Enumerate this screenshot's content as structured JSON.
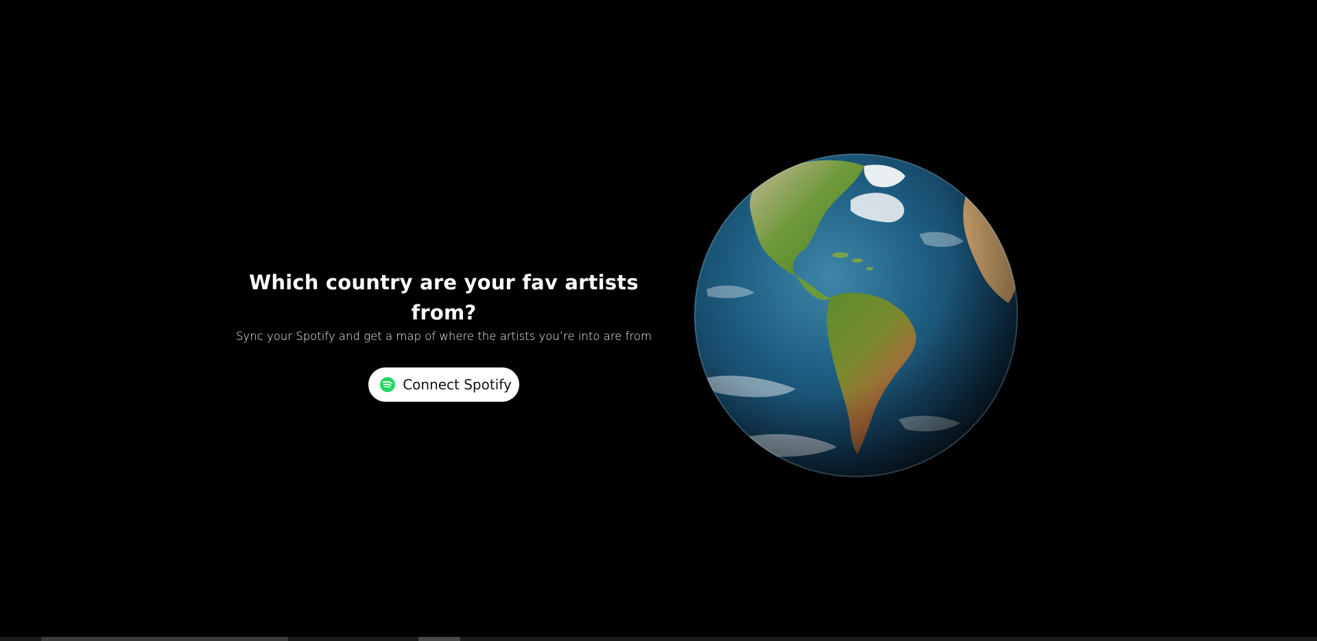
{
  "hero": {
    "headline": "Which country are your fav artists from?",
    "subline": "Sync your Spotify and get a map of where the artists you’re into are from",
    "connect_button_label": "Connect Spotify",
    "connect_button_icon": "spotify-icon"
  },
  "colors": {
    "background": "#000000",
    "button_bg": "#ffffff",
    "spotify_green": "#1ed760",
    "text_primary": "#ffffff"
  }
}
